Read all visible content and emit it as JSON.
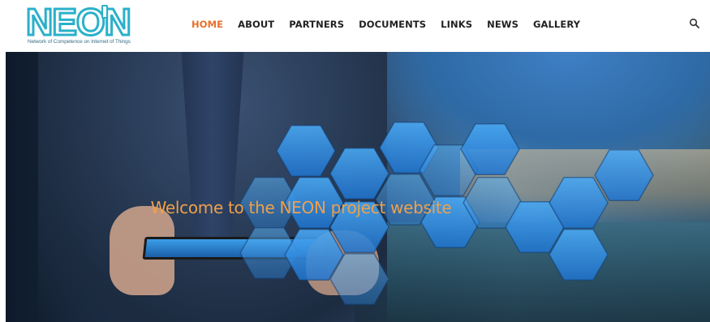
{
  "brand": {
    "logo_text": "NEON",
    "tagline": "Network of Competence on Internet of Things",
    "accent_color": "#2bb0c9"
  },
  "nav": {
    "items": [
      {
        "label": "HOME",
        "active": true
      },
      {
        "label": "ABOUT",
        "active": false
      },
      {
        "label": "PARTNERS",
        "active": false
      },
      {
        "label": "DOCUMENTS",
        "active": false
      },
      {
        "label": "LINKS",
        "active": false
      },
      {
        "label": "NEWS",
        "active": false
      },
      {
        "label": "GALLERY",
        "active": false
      }
    ],
    "active_color": "#e8702a",
    "search_icon": "search-icon"
  },
  "hero": {
    "headline": "Welcome to the NEON project website",
    "headline_color": "#f0a04a",
    "hexagon_color": "#2f8fe8"
  }
}
